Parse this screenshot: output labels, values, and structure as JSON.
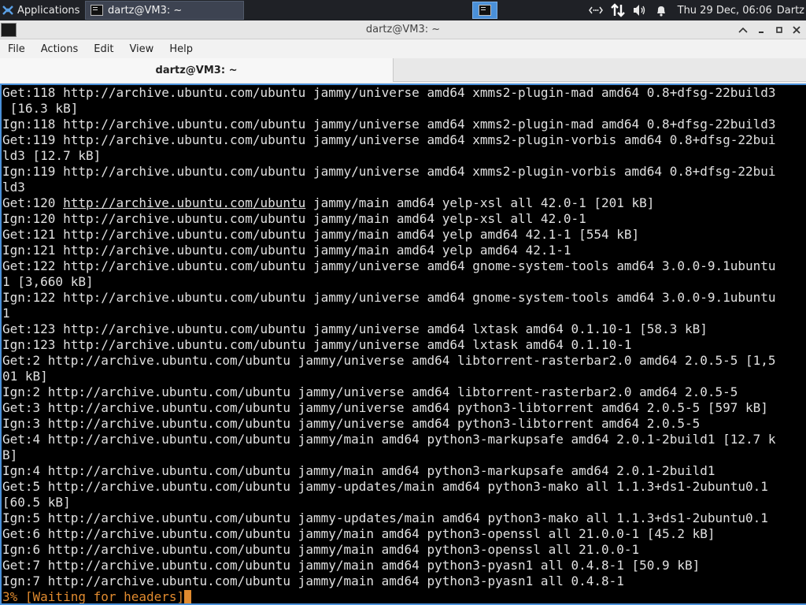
{
  "panel": {
    "applications_label": "Applications",
    "task_title": "dartz@VM3: ~",
    "clock": "Thu 29 Dec, 06:06",
    "user": "Dartz",
    "tray": [
      "network-icon",
      "transfer-arrows-icon",
      "volume-icon",
      "notification-bell-icon"
    ]
  },
  "window": {
    "title": "dartz@VM3: ~",
    "menu": [
      "File",
      "Actions",
      "Edit",
      "View",
      "Help"
    ],
    "tab_title": "dartz@VM3: ~"
  },
  "terminal": {
    "lines": [
      "Get:118 http://archive.ubuntu.com/ubuntu jammy/universe amd64 xmms2-plugin-mad amd64 0.8+dfsg-22build3",
      " [16.3 kB]",
      "Ign:118 http://archive.ubuntu.com/ubuntu jammy/universe amd64 xmms2-plugin-mad amd64 0.8+dfsg-22build3",
      "Get:119 http://archive.ubuntu.com/ubuntu jammy/universe amd64 xmms2-plugin-vorbis amd64 0.8+dfsg-22bui",
      "ld3 [12.7 kB]",
      "Ign:119 http://archive.ubuntu.com/ubuntu jammy/universe amd64 xmms2-plugin-vorbis amd64 0.8+dfsg-22bui",
      "ld3",
      "Get:120 http://archive.ubuntu.com/ubuntu jammy/main amd64 yelp-xsl all 42.0-1 [201 kB]",
      "Ign:120 http://archive.ubuntu.com/ubuntu jammy/main amd64 yelp-xsl all 42.0-1",
      "Get:121 http://archive.ubuntu.com/ubuntu jammy/main amd64 yelp amd64 42.1-1 [554 kB]",
      "Ign:121 http://archive.ubuntu.com/ubuntu jammy/main amd64 yelp amd64 42.1-1",
      "Get:122 http://archive.ubuntu.com/ubuntu jammy/universe amd64 gnome-system-tools amd64 3.0.0-9.1ubuntu",
      "1 [3,660 kB]",
      "Ign:122 http://archive.ubuntu.com/ubuntu jammy/universe amd64 gnome-system-tools amd64 3.0.0-9.1ubuntu",
      "1",
      "Get:123 http://archive.ubuntu.com/ubuntu jammy/universe amd64 lxtask amd64 0.1.10-1 [58.3 kB]",
      "Ign:123 http://archive.ubuntu.com/ubuntu jammy/universe amd64 lxtask amd64 0.1.10-1",
      "Get:2 http://archive.ubuntu.com/ubuntu jammy/universe amd64 libtorrent-rasterbar2.0 amd64 2.0.5-5 [1,5",
      "01 kB]",
      "Ign:2 http://archive.ubuntu.com/ubuntu jammy/universe amd64 libtorrent-rasterbar2.0 amd64 2.0.5-5",
      "Get:3 http://archive.ubuntu.com/ubuntu jammy/universe amd64 python3-libtorrent amd64 2.0.5-5 [597 kB]",
      "Ign:3 http://archive.ubuntu.com/ubuntu jammy/universe amd64 python3-libtorrent amd64 2.0.5-5",
      "Get:4 http://archive.ubuntu.com/ubuntu jammy/main amd64 python3-markupsafe amd64 2.0.1-2build1 [12.7 k",
      "B]",
      "Ign:4 http://archive.ubuntu.com/ubuntu jammy/main amd64 python3-markupsafe amd64 2.0.1-2build1",
      "Get:5 http://archive.ubuntu.com/ubuntu jammy-updates/main amd64 python3-mako all 1.1.3+ds1-2ubuntu0.1",
      "[60.5 kB]",
      "Ign:5 http://archive.ubuntu.com/ubuntu jammy-updates/main amd64 python3-mako all 1.1.3+ds1-2ubuntu0.1",
      "Get:6 http://archive.ubuntu.com/ubuntu jammy/main amd64 python3-openssl all 21.0.0-1 [45.2 kB]",
      "Ign:6 http://archive.ubuntu.com/ubuntu jammy/main amd64 python3-openssl all 21.0.0-1",
      "Get:7 http://archive.ubuntu.com/ubuntu jammy/main amd64 python3-pyasn1 all 0.4.8-1 [50.9 kB]",
      "Ign:7 http://archive.ubuntu.com/ubuntu jammy/main amd64 python3-pyasn1 all 0.4.8-1"
    ],
    "hovered_link": "http://archive.ubuntu.com/ubuntu",
    "status_line": "3% [Waiting for headers]",
    "colors": {
      "text": "#e0e0e0",
      "status": "#e08a2e",
      "background": "#000000",
      "focus_border": "#4a90d9"
    }
  }
}
